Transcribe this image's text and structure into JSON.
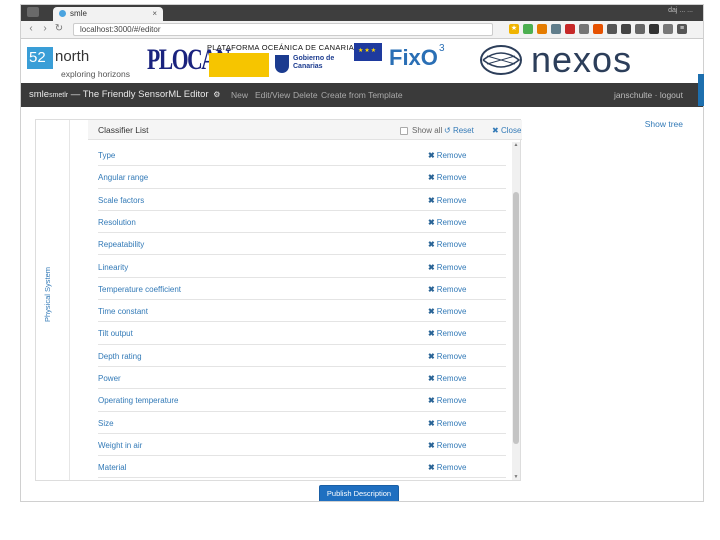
{
  "browser": {
    "tab_title": "smle",
    "tab_close": "×",
    "url": "localhost:3000/#/editor",
    "top_right_text": "daj ... ..."
  },
  "banner": {
    "org_52n_box": "52",
    "org_52n_word": "north",
    "org_52n_tagline": "exploring horizons",
    "plocan": "PLOCAN",
    "plocan_subtitle": "PLATAFORMA OCEÁNICA DE CANARIAS",
    "gov_canarias": "Gobierno de Canarias",
    "fixo3": "FixO",
    "fixo3_sup": "3",
    "nexos": "nexos"
  },
  "navbar": {
    "brand_main": "smle",
    "brand_sub": "smetlr",
    "brand_rest": " — The Friendly SensorML Editor",
    "links": [
      "New",
      "Edit/View",
      "Delete",
      "Create from Template"
    ],
    "user": "janschulte · logout"
  },
  "main": {
    "show_tree": "Show tree",
    "side_label": "Physical System",
    "classifier": {
      "title": "Classifier List",
      "show_all": "Show all",
      "reset": "Reset",
      "close": "Close",
      "remove_label": "Remove",
      "items": [
        "Type",
        "Angular range",
        "Scale factors",
        "Resolution",
        "Repeatability",
        "Linearity",
        "Temperature coefficient",
        "Time constant",
        "Tilt output",
        "Depth rating",
        "Power",
        "Operating temperature",
        "Size",
        "Weight in air",
        "Material"
      ]
    },
    "publish": "Publish Description"
  },
  "colors": {
    "link": "#337ab7",
    "navbar_bg": "#3a3a3a",
    "primary_button": "#1f6fc0"
  }
}
